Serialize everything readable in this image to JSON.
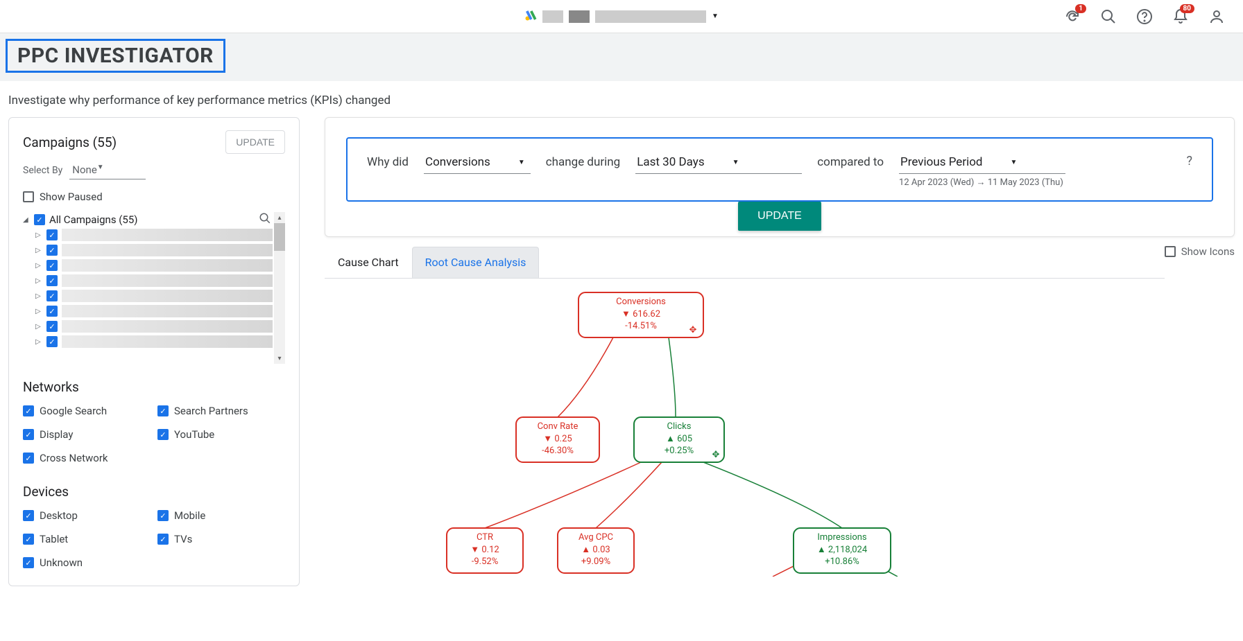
{
  "topbar": {
    "notification_badge": "1",
    "bell_badge": "80"
  },
  "page": {
    "title": "PPC INVESTIGATOR",
    "subtitle": "Investigate why performance of key performance metrics (KPIs) changed"
  },
  "sidebar": {
    "campaigns_heading": "Campaigns (55)",
    "update_btn": "UPDATE",
    "select_by_label": "Select By",
    "select_by_value": "None",
    "show_paused": "Show Paused",
    "all_campaigns": "All Campaigns (55)",
    "networks_heading": "Networks",
    "networks": [
      "Google Search",
      "Search Partners",
      "Display",
      "YouTube",
      "Cross Network"
    ],
    "devices_heading": "Devices",
    "devices": [
      "Desktop",
      "Mobile",
      "Tablet",
      "TVs",
      "Unknown"
    ]
  },
  "query": {
    "why_did": "Why did",
    "metric": "Conversions",
    "change_during": "change during",
    "period": "Last 30 Days",
    "compared_to": "compared to",
    "comparison": "Previous Period",
    "date_range": "12 Apr 2023 (Wed) → 11 May 2023 (Thu)",
    "help": "?",
    "update_btn": "UPDATE"
  },
  "tabs": {
    "cause_chart": "Cause Chart",
    "root_cause": "Root Cause Analysis",
    "show_icons": "Show Icons"
  },
  "chart_data": {
    "type": "tree",
    "nodes": [
      {
        "id": "conversions",
        "label": "Conversions",
        "direction": "down",
        "value": "616.62",
        "change": "-14.51%",
        "color": "red"
      },
      {
        "id": "convrate",
        "label": "Conv Rate",
        "direction": "down",
        "value": "0.25",
        "change": "-46.30%",
        "color": "red",
        "parent": "conversions"
      },
      {
        "id": "clicks",
        "label": "Clicks",
        "direction": "up",
        "value": "605",
        "change": "+0.25%",
        "color": "green",
        "parent": "conversions"
      },
      {
        "id": "ctr",
        "label": "CTR",
        "direction": "down",
        "value": "0.12",
        "change": "-9.52%",
        "color": "red",
        "parent": "clicks"
      },
      {
        "id": "avgcpc",
        "label": "Avg CPC",
        "direction": "up",
        "value": "0.03",
        "change": "+9.09%",
        "color": "red",
        "parent": "clicks"
      },
      {
        "id": "impressions",
        "label": "Impressions",
        "direction": "up",
        "value": "2,118,024",
        "change": "+10.86%",
        "color": "green",
        "parent": "clicks"
      }
    ]
  }
}
